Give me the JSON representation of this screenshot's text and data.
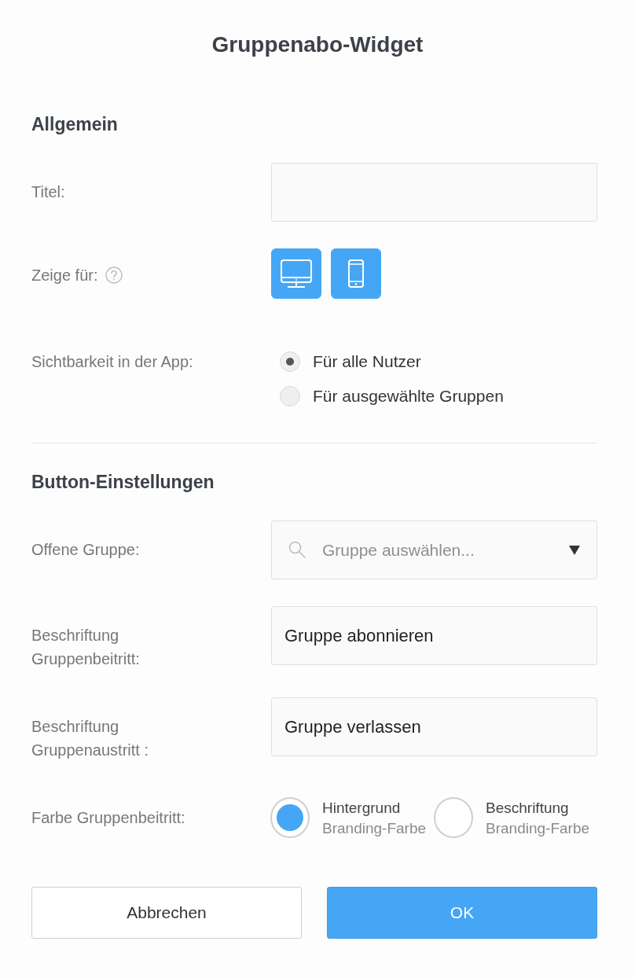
{
  "dialog": {
    "title": "Gruppenabo-Widget"
  },
  "sections": [
    {
      "heading": "Allgemein",
      "fields": [
        {
          "kind": "text",
          "label": "Titel:"
        },
        {
          "kind": "devices",
          "label": "Zeige für:",
          "help": true,
          "options": [
            {
              "kind": "desktop",
              "selected": true
            },
            {
              "kind": "mobile",
              "selected": true
            }
          ]
        },
        {
          "kind": "radio",
          "label": "Sichtbarkeit in der App:",
          "options": [
            {
              "label": "Für alle Nutzer",
              "selected": true
            },
            {
              "label": "Für ausgewählte Gruppen",
              "selected": false
            }
          ]
        }
      ]
    },
    {
      "heading": "Button-Einstellungen",
      "fields": [
        {
          "kind": "select",
          "label": "Offene Gruppe:",
          "placeholder": "Gruppe auswählen..."
        },
        {
          "kind": "text",
          "label": "Beschriftung Gruppenbeitritt:",
          "value": "Gruppe abonnieren"
        },
        {
          "kind": "text",
          "label": "Beschriftung Gruppenaustritt :",
          "value": "Gruppe verlassen"
        },
        {
          "kind": "color",
          "label": "Farbe Gruppenbeitritt:",
          "options": [
            {
              "title": "Hintergrund",
              "subtitle": "Branding-Farbe",
              "selected": true
            },
            {
              "title": "Beschriftung",
              "subtitle": "Branding-Farbe",
              "selected": false
            }
          ]
        }
      ]
    }
  ],
  "buttons": [
    {
      "label": "Abbrechen",
      "kind": "secondary"
    },
    {
      "label": "OK",
      "kind": "primary"
    }
  ]
}
